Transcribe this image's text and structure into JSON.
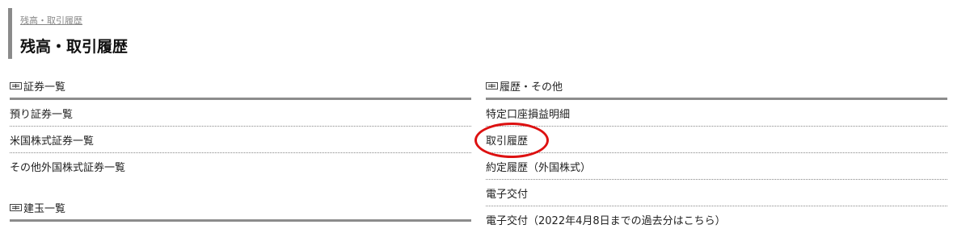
{
  "header": {
    "breadcrumb": "残高・取引履歴",
    "title": "残高・取引履歴"
  },
  "left": {
    "section1": {
      "title": "証券一覧",
      "icon": "list-icon",
      "items": [
        "預り証券一覧",
        "米国株式証券一覧",
        "その他外国株式証券一覧"
      ]
    },
    "section2": {
      "title": "建玉一覧",
      "icon": "list-icon"
    }
  },
  "right": {
    "section1": {
      "title": "履歴・その他",
      "icon": "list-icon",
      "items": [
        "特定口座損益明細",
        "取引履歴",
        "約定履歴（外国株式）",
        "電子交付",
        "電子交付（2022年4月8日までの過去分はこちら）"
      ]
    }
  },
  "annotation": {
    "color": "#dd1111"
  }
}
